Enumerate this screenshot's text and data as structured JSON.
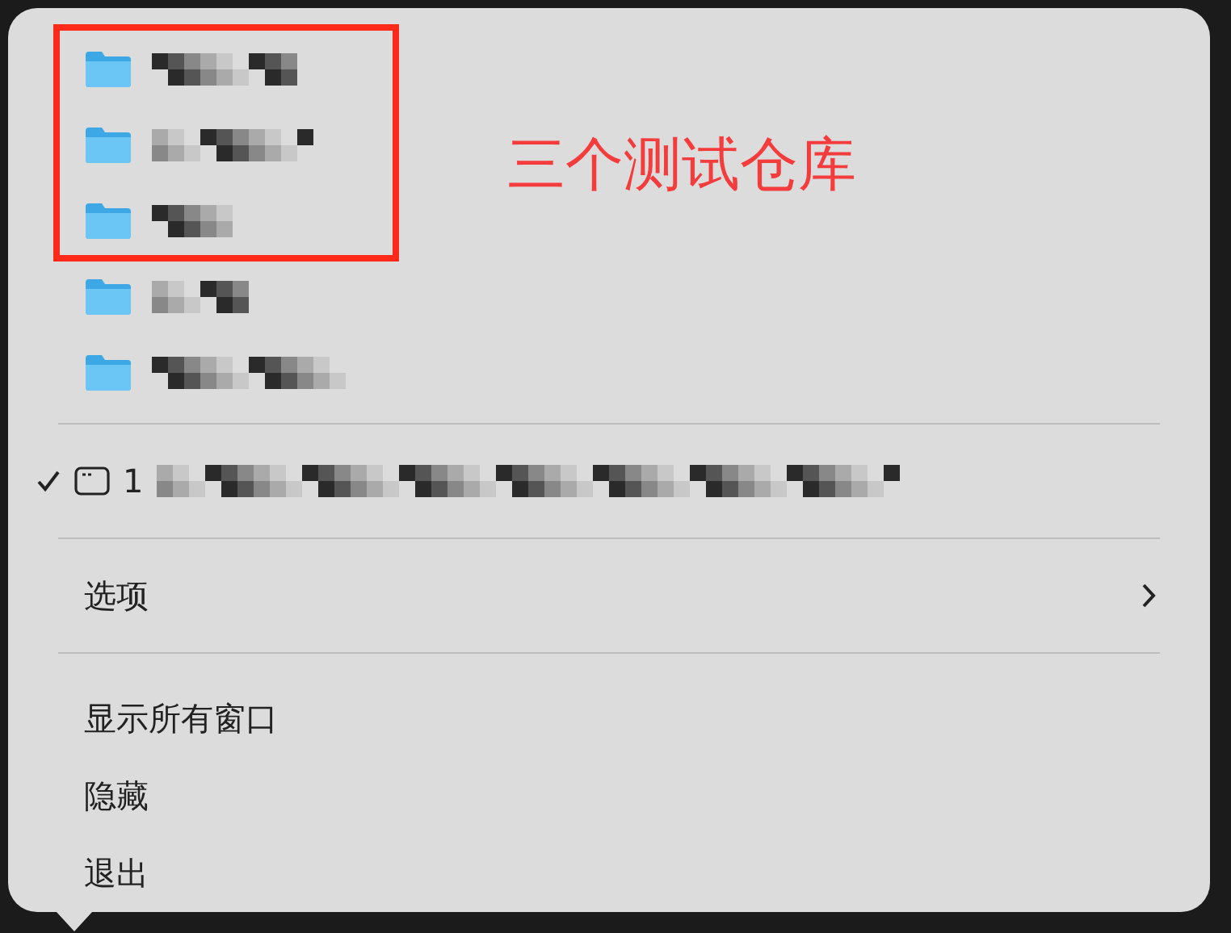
{
  "menu": {
    "recent_folders": [
      {
        "kind": "folder",
        "redacted": true,
        "highlighted": true
      },
      {
        "kind": "folder",
        "redacted": true,
        "highlighted": true
      },
      {
        "kind": "folder",
        "redacted": true,
        "highlighted": true
      },
      {
        "kind": "folder",
        "redacted": true,
        "highlighted": false
      },
      {
        "kind": "folder",
        "redacted": true,
        "highlighted": false
      }
    ],
    "window_item": {
      "checked": true,
      "label": "1",
      "redacted": true
    },
    "options_item": {
      "label": "选项",
      "has_submenu": true
    },
    "actions": [
      {
        "label": "显示所有窗口"
      },
      {
        "label": "隐藏"
      },
      {
        "label": "退出"
      }
    ]
  },
  "annotation": {
    "text": "三个测试仓库"
  }
}
